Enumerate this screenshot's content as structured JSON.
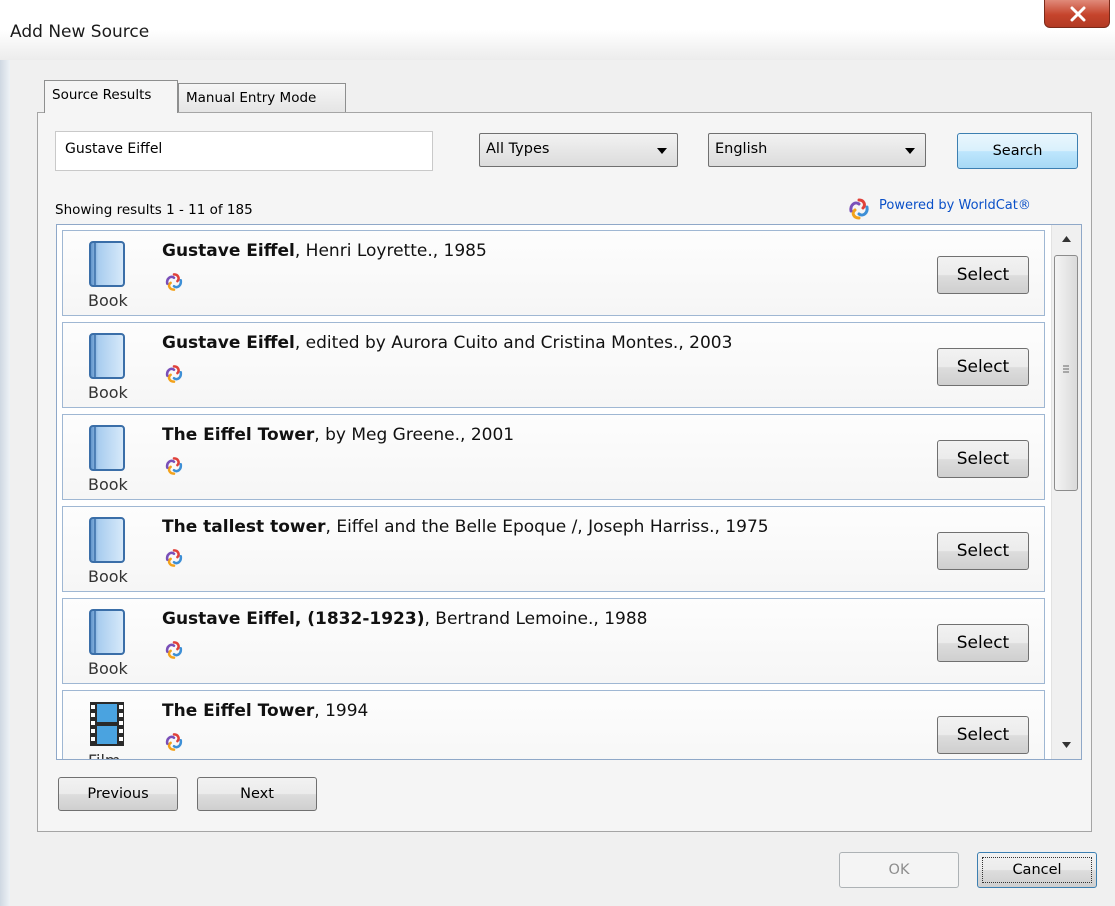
{
  "window": {
    "title": "Add New Source"
  },
  "tabs": [
    {
      "label": "Source Results",
      "active": true
    },
    {
      "label": "Manual Entry Mode",
      "active": false
    }
  ],
  "search": {
    "query": "Gustave Eiffel",
    "type_filter": "All Types",
    "language": "English",
    "button_label": "Search"
  },
  "results_info": {
    "showing": "Showing results 1 - 11 of 185",
    "powered_by": "Powered by WorldCat®"
  },
  "results": [
    {
      "type": "Book",
      "type_icon": "book-icon",
      "title": "Gustave Eiffel",
      "detail": ", Henri Loyrette., 1985",
      "button": "Select"
    },
    {
      "type": "Book",
      "type_icon": "book-icon",
      "title": "Gustave Eiffel",
      "detail": ", edited by Aurora Cuito and Cristina Montes., 2003",
      "button": "Select"
    },
    {
      "type": "Book",
      "type_icon": "book-icon",
      "title": "The Eiffel Tower",
      "detail": ", by Meg Greene., 2001",
      "button": "Select"
    },
    {
      "type": "Book",
      "type_icon": "book-icon",
      "title": "The tallest tower",
      "detail": ", Eiffel and the Belle Epoque /, Joseph Harriss., 1975",
      "button": "Select"
    },
    {
      "type": "Book",
      "type_icon": "book-icon",
      "title": "Gustave Eiffel, (1832-1923)",
      "detail": ", Bertrand Lemoine., 1988",
      "button": "Select"
    },
    {
      "type": "Film",
      "type_icon": "film-icon",
      "title": "The Eiffel Tower",
      "detail": ", 1994",
      "button": "Select"
    }
  ],
  "pagination": {
    "previous": "Previous",
    "next": "Next"
  },
  "footer": {
    "ok": "OK",
    "cancel": "Cancel"
  },
  "colors": {
    "link": "#0a50c8",
    "close_button": "#c5442c",
    "focus_border": "#3c7fb1"
  }
}
